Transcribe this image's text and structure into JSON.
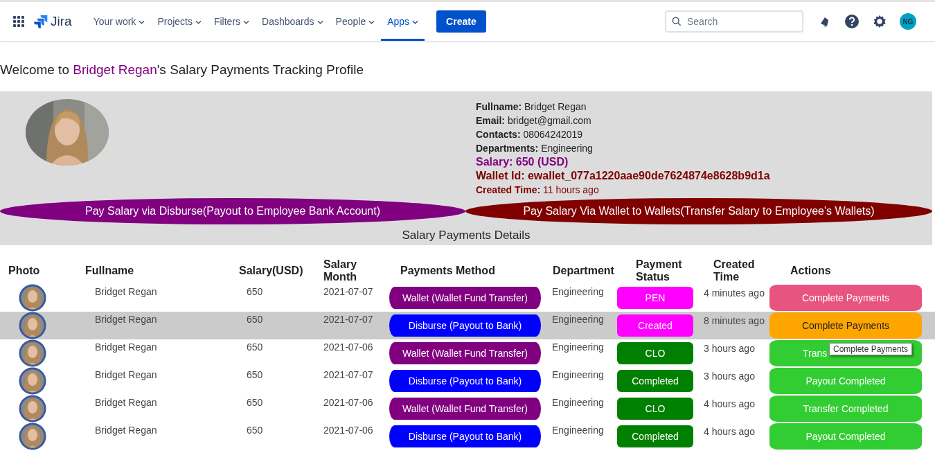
{
  "nav": {
    "logo": "Jira",
    "items": [
      {
        "label": "Your work",
        "selected": false
      },
      {
        "label": "Projects",
        "selected": false
      },
      {
        "label": "Filters",
        "selected": false
      },
      {
        "label": "Dashboards",
        "selected": false
      },
      {
        "label": "People",
        "selected": false
      },
      {
        "label": "Apps",
        "selected": true
      }
    ],
    "create": "Create",
    "search": {
      "placeholder": "Search"
    },
    "avatar": "NG"
  },
  "welcome": {
    "prefix": "Welcome to ",
    "name": "Bridget Regan",
    "suffix": "'s Salary Payments Tracking Profile"
  },
  "profile": {
    "fields": [
      {
        "kind": "plain",
        "label": "Fullname:",
        "value": "Bridget Regan"
      },
      {
        "kind": "plain",
        "label": "Email:",
        "value": "bridget@gmail.com"
      },
      {
        "kind": "plain",
        "label": "Contacts:",
        "value": "08064242019"
      },
      {
        "kind": "plain",
        "label": "Departments:",
        "value": "Engineering"
      },
      {
        "kind": "salary",
        "label": "Salary:",
        "value": "650 (USD)"
      },
      {
        "kind": "wallet",
        "label": "Wallet Id:",
        "value": "ewallet_077a1220aae90de7624874e8628b9d1a"
      },
      {
        "kind": "created",
        "label": "Created Time:",
        "value": "11 hours ago"
      }
    ],
    "buttons": [
      {
        "kind": "disburse",
        "label": "Pay Salary via Disburse(Payout to Employee Bank Account)"
      },
      {
        "kind": "wallet",
        "label": "Pay Salary Via Wallet to Wallets(Transfer Salary to Employee's Wallets)"
      }
    ],
    "section_title": "Salary Payments Details"
  },
  "table": {
    "columns": [
      "Photo",
      "Fullname",
      "Salary(USD)",
      "Salary Month",
      "Payments Method",
      "Department",
      "Payment Status",
      "Created Time",
      "Actions"
    ],
    "rows": [
      {
        "selected": false,
        "name": "Bridget Regan",
        "salary": "650",
        "month": "2021-07-07",
        "method": {
          "kind": "wallet",
          "label": "Wallet (Wallet Fund Transfer)"
        },
        "department": "Engineering",
        "status": {
          "label": "PEN",
          "color": "#ff00ff"
        },
        "created": "4 minutes ago",
        "action": {
          "kind": "pending",
          "label": "Complete Payments"
        }
      },
      {
        "selected": true,
        "name": "Bridget Regan",
        "salary": "650",
        "month": "2021-07-07",
        "method": {
          "kind": "disburse",
          "label": "Disburse (Payout to Bank)"
        },
        "department": "Engineering",
        "status": {
          "label": "Created",
          "color": "#ff00ff"
        },
        "created": "8 minutes ago",
        "action": {
          "kind": "created",
          "label": "Complete Payments"
        }
      },
      {
        "selected": false,
        "name": "Bridget Regan",
        "salary": "650",
        "month": "2021-07-06",
        "method": {
          "kind": "wallet",
          "label": "Wallet (Wallet Fund Transfer)"
        },
        "department": "Engineering",
        "status": {
          "label": "CLO",
          "color": "#008000"
        },
        "created": "3 hours ago",
        "action": {
          "kind": "completed",
          "label": "Trans"
        }
      },
      {
        "selected": false,
        "name": "Bridget Regan",
        "salary": "650",
        "month": "2021-07-07",
        "method": {
          "kind": "disburse",
          "label": "Disburse (Payout to Bank)"
        },
        "department": "Engineering",
        "status": {
          "label": "Completed",
          "color": "#008000"
        },
        "created": "3 hours ago",
        "action": {
          "kind": "completed",
          "label": "Payout Completed"
        }
      },
      {
        "selected": false,
        "name": "Bridget Regan",
        "salary": "650",
        "month": "2021-07-06",
        "method": {
          "kind": "wallet",
          "label": "Wallet (Wallet Fund Transfer)"
        },
        "department": "Engineering",
        "status": {
          "label": "CLO",
          "color": "#008000"
        },
        "created": "4 hours ago",
        "action": {
          "kind": "completed",
          "label": "Transfer Completed"
        }
      },
      {
        "selected": false,
        "name": "Bridget Regan",
        "salary": "650",
        "month": "2021-07-06",
        "method": {
          "kind": "disburse",
          "label": "Disburse (Payout to Bank)"
        },
        "department": "Engineering",
        "status": {
          "label": "Completed",
          "color": "#008000"
        },
        "created": "4 hours ago",
        "action": {
          "kind": "completed",
          "label": "Payout Completed"
        }
      }
    ],
    "tooltip": "Complete Payments"
  }
}
